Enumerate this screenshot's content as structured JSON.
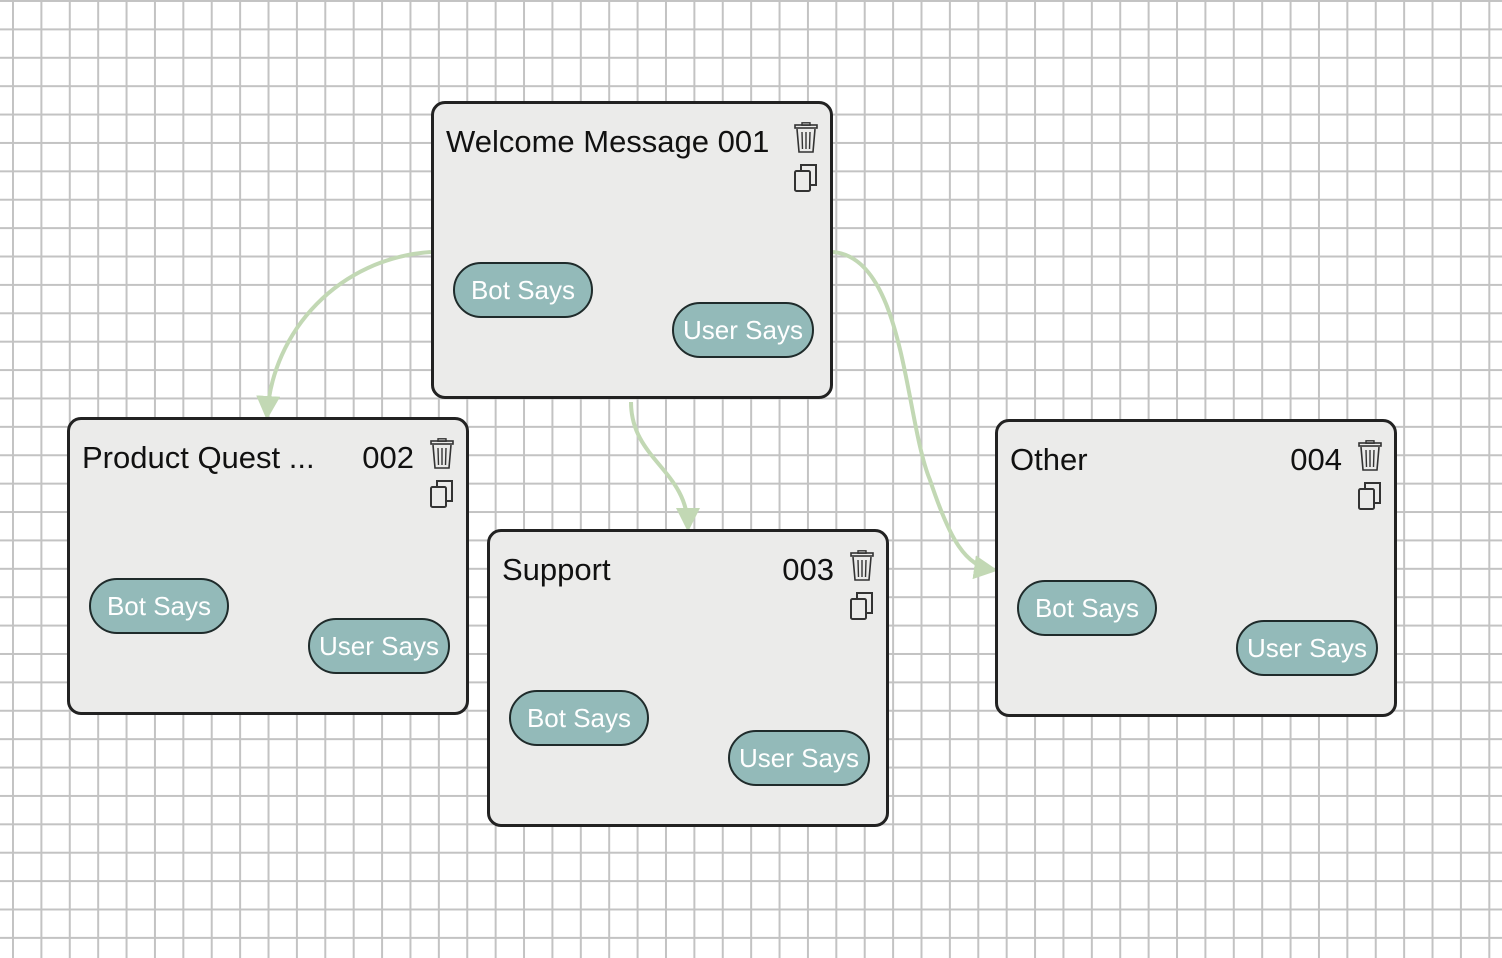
{
  "nodes": [
    {
      "title": "Welcome Message 001",
      "id": "",
      "bot_label": "Bot Says",
      "user_label": "User Says"
    },
    {
      "title": "Product Quest ...",
      "id": "002",
      "bot_label": "Bot Says",
      "user_label": "User Says"
    },
    {
      "title": "Support",
      "id": "003",
      "bot_label": "Bot Says",
      "user_label": "User Says"
    },
    {
      "title": "Other",
      "id": "004",
      "bot_label": "Bot Says",
      "user_label": "User Says"
    }
  ],
  "icons": {
    "delete": "trash-icon",
    "duplicate": "copy-icon"
  },
  "colors": {
    "connector": "#c2d8b4",
    "pill": "#93bab9",
    "node_background": "#ebebea",
    "node_border": "#222222"
  }
}
